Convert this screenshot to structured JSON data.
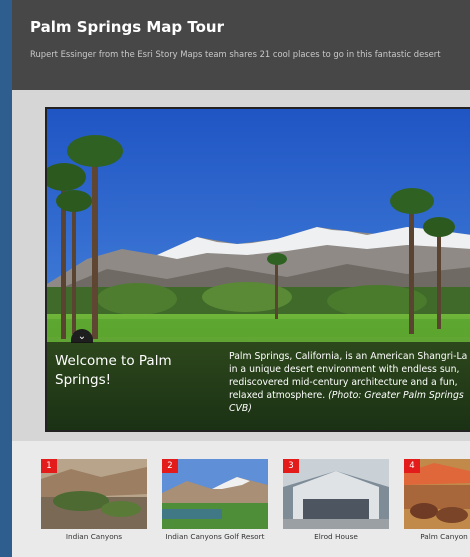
{
  "header": {
    "title": "Palm Springs Map Tour",
    "subtitle": "Rupert Essinger from the Esri Story Maps team shares 21 cool places to go in this fantastic desert"
  },
  "feature": {
    "toggle_icon": "chevron-down-icon",
    "caption_title": "Welcome to Palm Springs!",
    "caption_text": "Palm Springs, California, is an American Shangri-La in a unique desert environment with endless sun, rediscovered mid-century architecture and a fun, relaxed atmosphere.",
    "caption_credit": "(Photo: Greater Palm Springs CVB)"
  },
  "thumbnails": [
    {
      "number": "1",
      "label": "Indian Canyons"
    },
    {
      "number": "2",
      "label": "Indian Canyons Golf Resort"
    },
    {
      "number": "3",
      "label": "Elrod House"
    },
    {
      "number": "4",
      "label": "Palm Canyon"
    }
  ],
  "colors": {
    "page_background": "#2e5e8e",
    "header_background": "#474747",
    "badge": "#e31b1b"
  }
}
